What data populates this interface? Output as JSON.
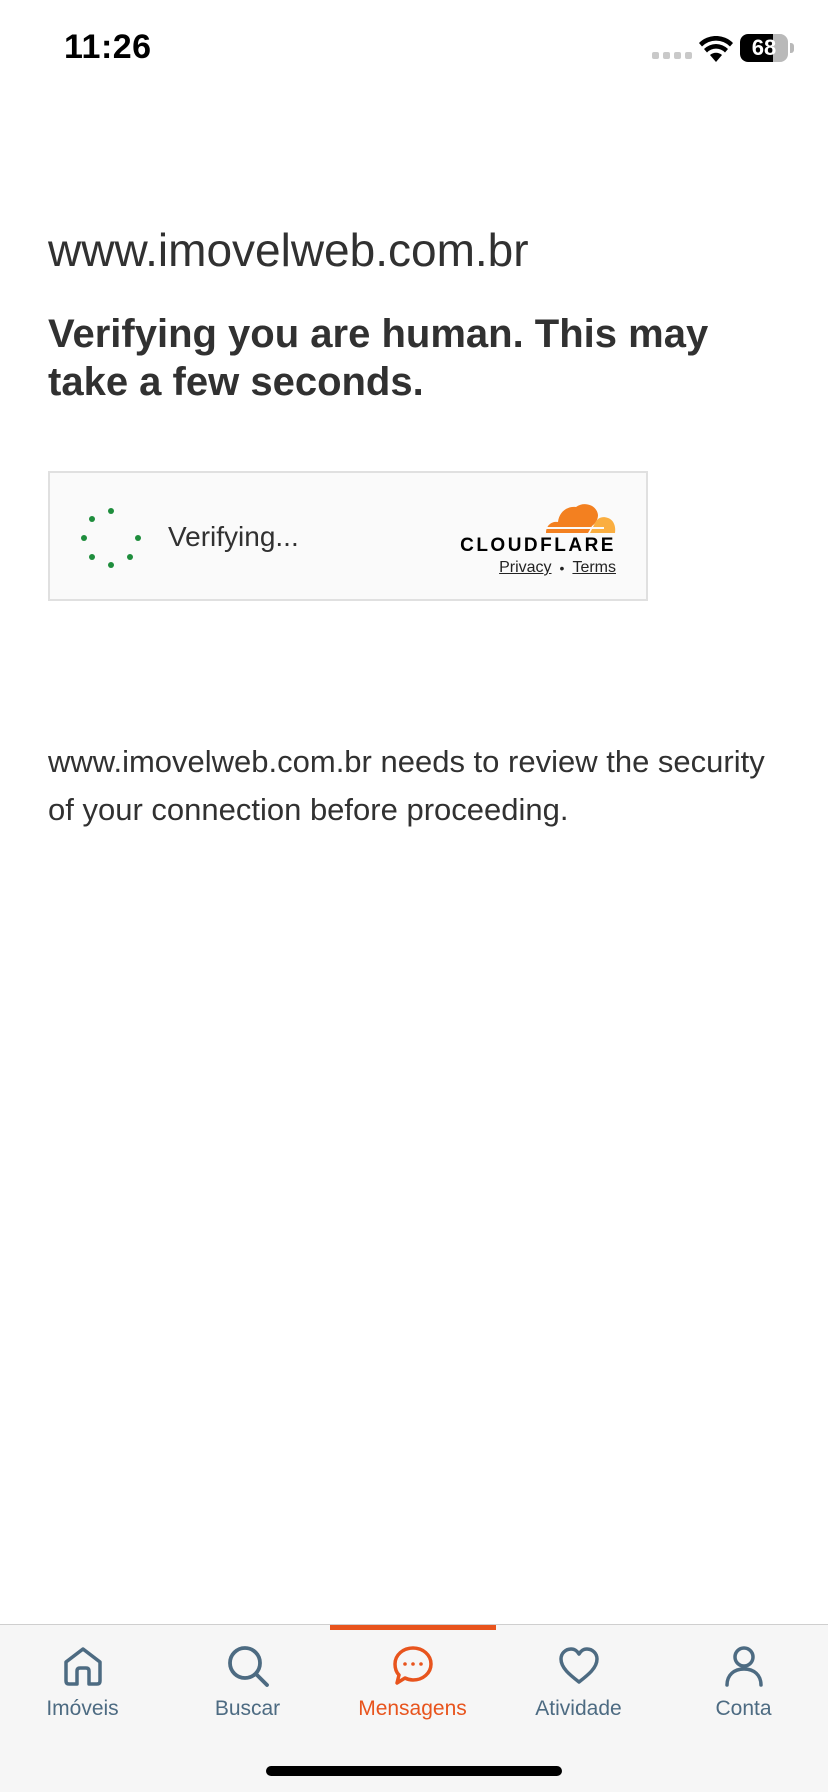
{
  "status_bar": {
    "time": "11:26",
    "battery_level": 68,
    "icons": [
      "signal-icon",
      "wifi-icon",
      "battery-icon"
    ]
  },
  "page": {
    "domain_title": "www.imovelweb.com.br",
    "heading": "Verifying you are human. This may take a few seconds.",
    "security_note": "www.imovelweb.com.br needs to review the security of your connection before proceeding."
  },
  "challenge_widget": {
    "status": "Verifying...",
    "brand": "CLOUDFLARE",
    "privacy_link": "Privacy",
    "separator": "•",
    "terms_link": "Terms",
    "spinner_color": "#1e8d3c",
    "logo_colors": [
      "#f38020",
      "#faae40"
    ]
  },
  "tab_bar": {
    "active_color": "#e8541d",
    "inactive_color": "#4d6b82",
    "items": [
      {
        "label": "Imóveis",
        "icon": "home-icon",
        "active": false
      },
      {
        "label": "Buscar",
        "icon": "search-icon",
        "active": false
      },
      {
        "label": "Mensagens",
        "icon": "chat-bubble-icon",
        "active": true
      },
      {
        "label": "Atividade",
        "icon": "heart-icon",
        "active": false
      },
      {
        "label": "Conta",
        "icon": "user-icon",
        "active": false
      }
    ]
  }
}
